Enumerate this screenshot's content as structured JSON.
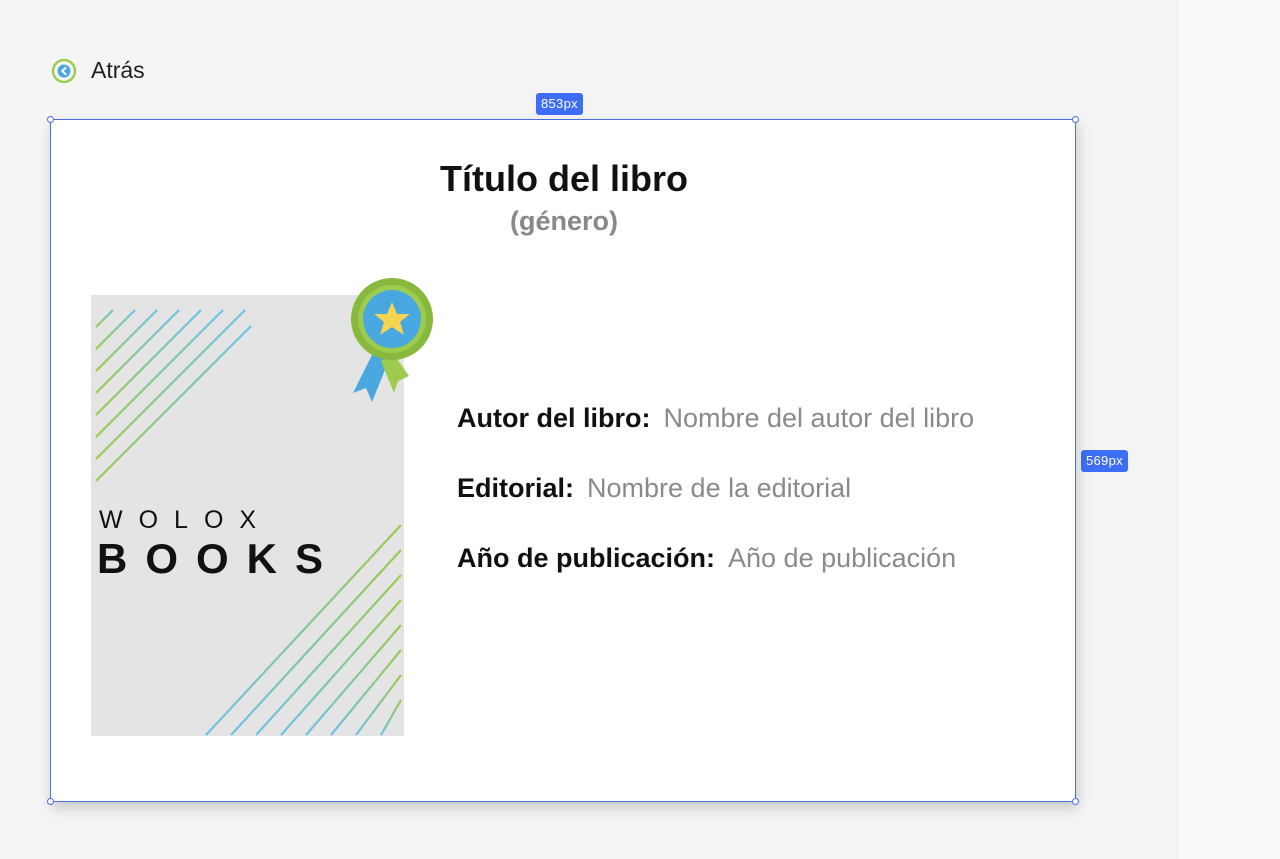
{
  "nav": {
    "back_label": "Atrás",
    "back_icon": "chevron-left-circle-icon"
  },
  "selection": {
    "width_badge": "853px",
    "height_badge": "569px",
    "color": "#3d6ef5"
  },
  "book": {
    "title": "Título del libro",
    "genre": "(género)",
    "cover": {
      "brand_line1": "WOLOX",
      "brand_line2": "BOOKS",
      "badge_icon": "award-ribbon-star-icon"
    },
    "details": [
      {
        "label": "Autor del libro:",
        "value": "Nombre del autor del libro"
      },
      {
        "label": "Editorial:",
        "value": "Nombre de la editorial"
      },
      {
        "label": "Año de publicación:",
        "value": "Año de publicación"
      }
    ]
  },
  "colors": {
    "accent_green": "#9ccb4e",
    "accent_blue": "#4aa8e0",
    "label_gray": "#8a8a8a"
  }
}
